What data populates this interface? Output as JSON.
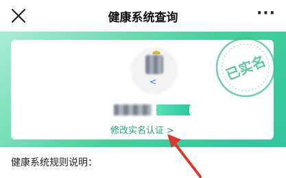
{
  "nav": {
    "title": "健康系统查询",
    "close_icon": "close-icon",
    "more_label": "···"
  },
  "card": {
    "avatar_icon": "user-avatar-blurred",
    "name_blurred": true,
    "verify_link_label": "修改实名认证",
    "verify_link_chevron": ">",
    "stamp_text": "已实名"
  },
  "rules": {
    "heading": "健康系统规则说明："
  },
  "colors": {
    "accent_green": "#1fa57c",
    "banner_start": "#a8ecd6",
    "banner_end": "#2ec5a0",
    "annotation_arrow": "#d93a2b"
  }
}
